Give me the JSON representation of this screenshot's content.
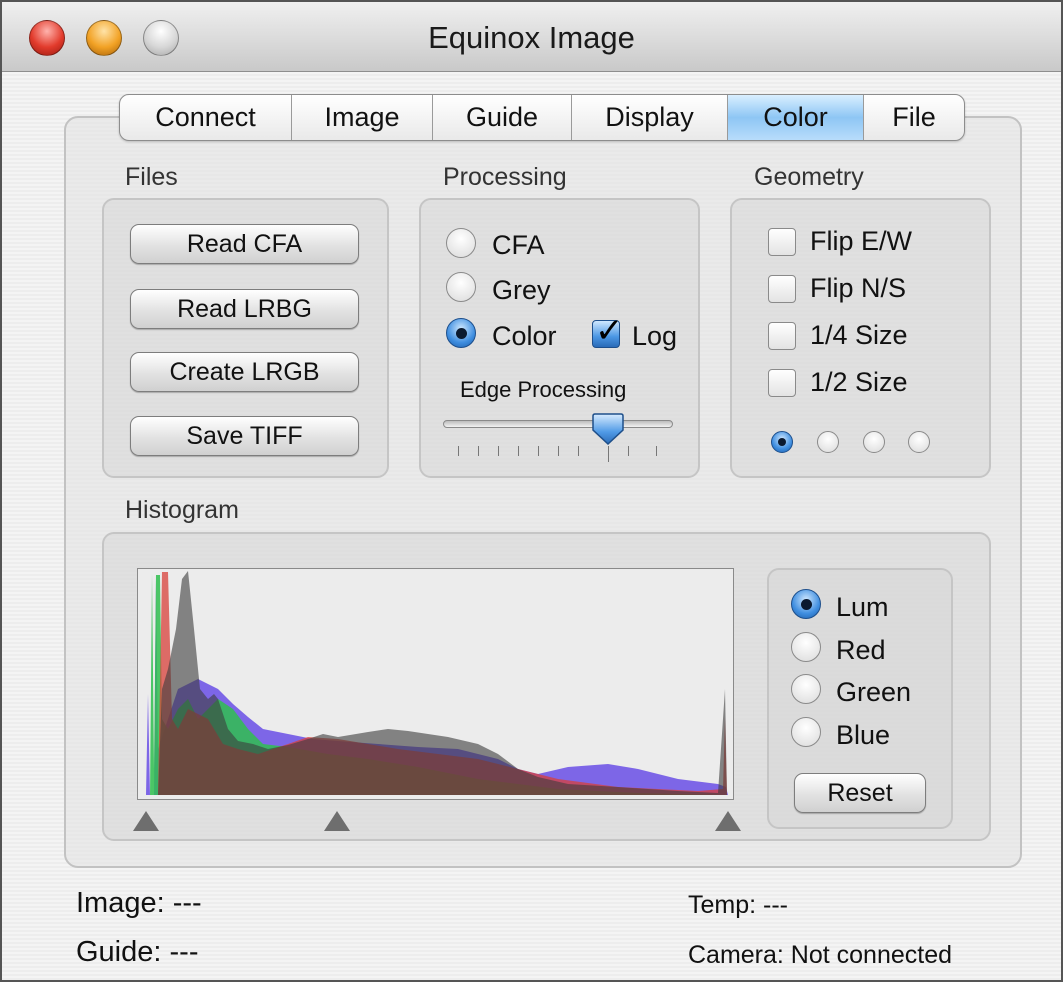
{
  "window": {
    "title": "Equinox Image"
  },
  "tabs": [
    "Connect",
    "Image",
    "Guide",
    "Display",
    "Color",
    "File"
  ],
  "active_tab": "Color",
  "files": {
    "label": "Files",
    "buttons": [
      "Read CFA",
      "Read LRBG",
      "Create LRGB",
      "Save TIFF"
    ]
  },
  "processing": {
    "label": "Processing",
    "options": [
      {
        "label": "CFA",
        "selected": false
      },
      {
        "label": "Grey",
        "selected": false
      },
      {
        "label": "Color",
        "selected": true
      }
    ],
    "log_label": "Log",
    "log_checked": true,
    "slider_label": "Edge Processing",
    "slider_value_fraction": 0.72
  },
  "geometry": {
    "label": "Geometry",
    "checkboxes": [
      {
        "label": "Flip E/W",
        "checked": false
      },
      {
        "label": "Flip N/S",
        "checked": false
      },
      {
        "label": "1/4 Size",
        "checked": false
      },
      {
        "label": "1/2 Size",
        "checked": false
      }
    ],
    "small_radios_selected_index": 0
  },
  "histogram": {
    "label": "Histogram",
    "channels": [
      {
        "label": "Lum",
        "selected": true
      },
      {
        "label": "Red",
        "selected": false
      },
      {
        "label": "Green",
        "selected": false
      },
      {
        "label": "Blue",
        "selected": false
      }
    ],
    "reset_label": "Reset",
    "colors": {
      "lum": "#3c3c3c",
      "red": "#d8403a",
      "green": "#2fbf4f",
      "blue": "#5a3ee0"
    }
  },
  "status": {
    "image": "Image: ---",
    "guide": "Guide: ---",
    "temp": "Temp: ---",
    "camera": "Camera: Not connected"
  }
}
